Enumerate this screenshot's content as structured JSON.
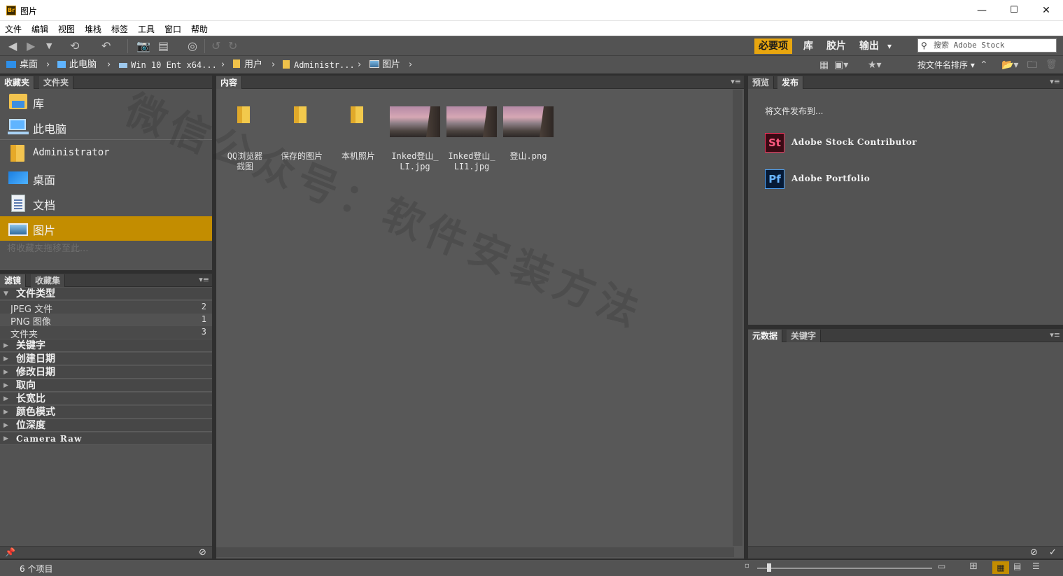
{
  "window": {
    "title": "图片",
    "app_icon_text": "Br",
    "controls": {
      "minimize": "—",
      "maximize": "☐",
      "close": "✕"
    }
  },
  "menu": [
    "文件",
    "编辑",
    "视图",
    "堆栈",
    "标签",
    "工具",
    "窗口",
    "帮助"
  ],
  "toolbar": {
    "workspaces": [
      "必要项",
      "库",
      "胶片",
      "输出"
    ],
    "active_workspace": "必要项",
    "workspace_more": "▾",
    "search_placeholder": "搜索 Adobe Stock"
  },
  "path": {
    "crumbs": [
      "桌面",
      "此电脑",
      "Win 10 Ent x64...",
      "用户",
      "Administr...",
      "图片"
    ],
    "sort_label": "按文件名排序"
  },
  "favorites": {
    "tabs": [
      "收藏夹",
      "文件夹"
    ],
    "items": [
      "库",
      "此电脑",
      "Administrator",
      "桌面",
      "文档",
      "图片"
    ],
    "selected": "图片",
    "drop_hint": "将收藏夹拖移至此..."
  },
  "filter": {
    "tabs": [
      "滤镜",
      "收藏集"
    ],
    "sections": [
      "文件类型",
      "关键字",
      "创建日期",
      "修改日期",
      "取向",
      "长宽比",
      "颜色模式",
      "位深度",
      "Camera Raw"
    ],
    "file_types": [
      {
        "name": "JPEG 文件",
        "count": "2"
      },
      {
        "name": "PNG 图像",
        "count": "1"
      },
      {
        "name": "文件夹",
        "count": "3"
      }
    ]
  },
  "content": {
    "tab": "内容",
    "items": [
      {
        "name": "QQ浏览器截图",
        "line1": "QQ浏览器",
        "line2": "截图",
        "type": "folder"
      },
      {
        "name": "保存的图片",
        "line1": "保存的图片",
        "line2": "",
        "type": "folder"
      },
      {
        "name": "本机照片",
        "line1": "本机照片",
        "line2": "",
        "type": "folder"
      },
      {
        "name": "Inked登山_LI.jpg",
        "line1": "Inked登山_",
        "line2": "LI.jpg",
        "type": "image"
      },
      {
        "name": "Inked登山_LI1.jpg",
        "line1": "Inked登山_",
        "line2": "LI1.jpg",
        "type": "image"
      },
      {
        "name": "登山.png",
        "line1": "登山.png",
        "line2": "",
        "type": "image"
      }
    ]
  },
  "publish": {
    "tabs": [
      "预览",
      "发布"
    ],
    "heading": "将文件发布到...",
    "targets": [
      {
        "icon": "St",
        "label": "Adobe Stock Contributor",
        "color": "#e9325a"
      },
      {
        "icon": "Pf",
        "label": "Adobe Portfolio",
        "color": "#4fa3f7"
      }
    ]
  },
  "metadata": {
    "tabs": [
      "元数据",
      "关键字"
    ]
  },
  "status": {
    "item_count": "6 个项目"
  },
  "watermark": "微信公众号：软件安装方法",
  "colors": {
    "accent": "#e8a60f",
    "selection": "#c38d00",
    "panel": "#535353"
  }
}
